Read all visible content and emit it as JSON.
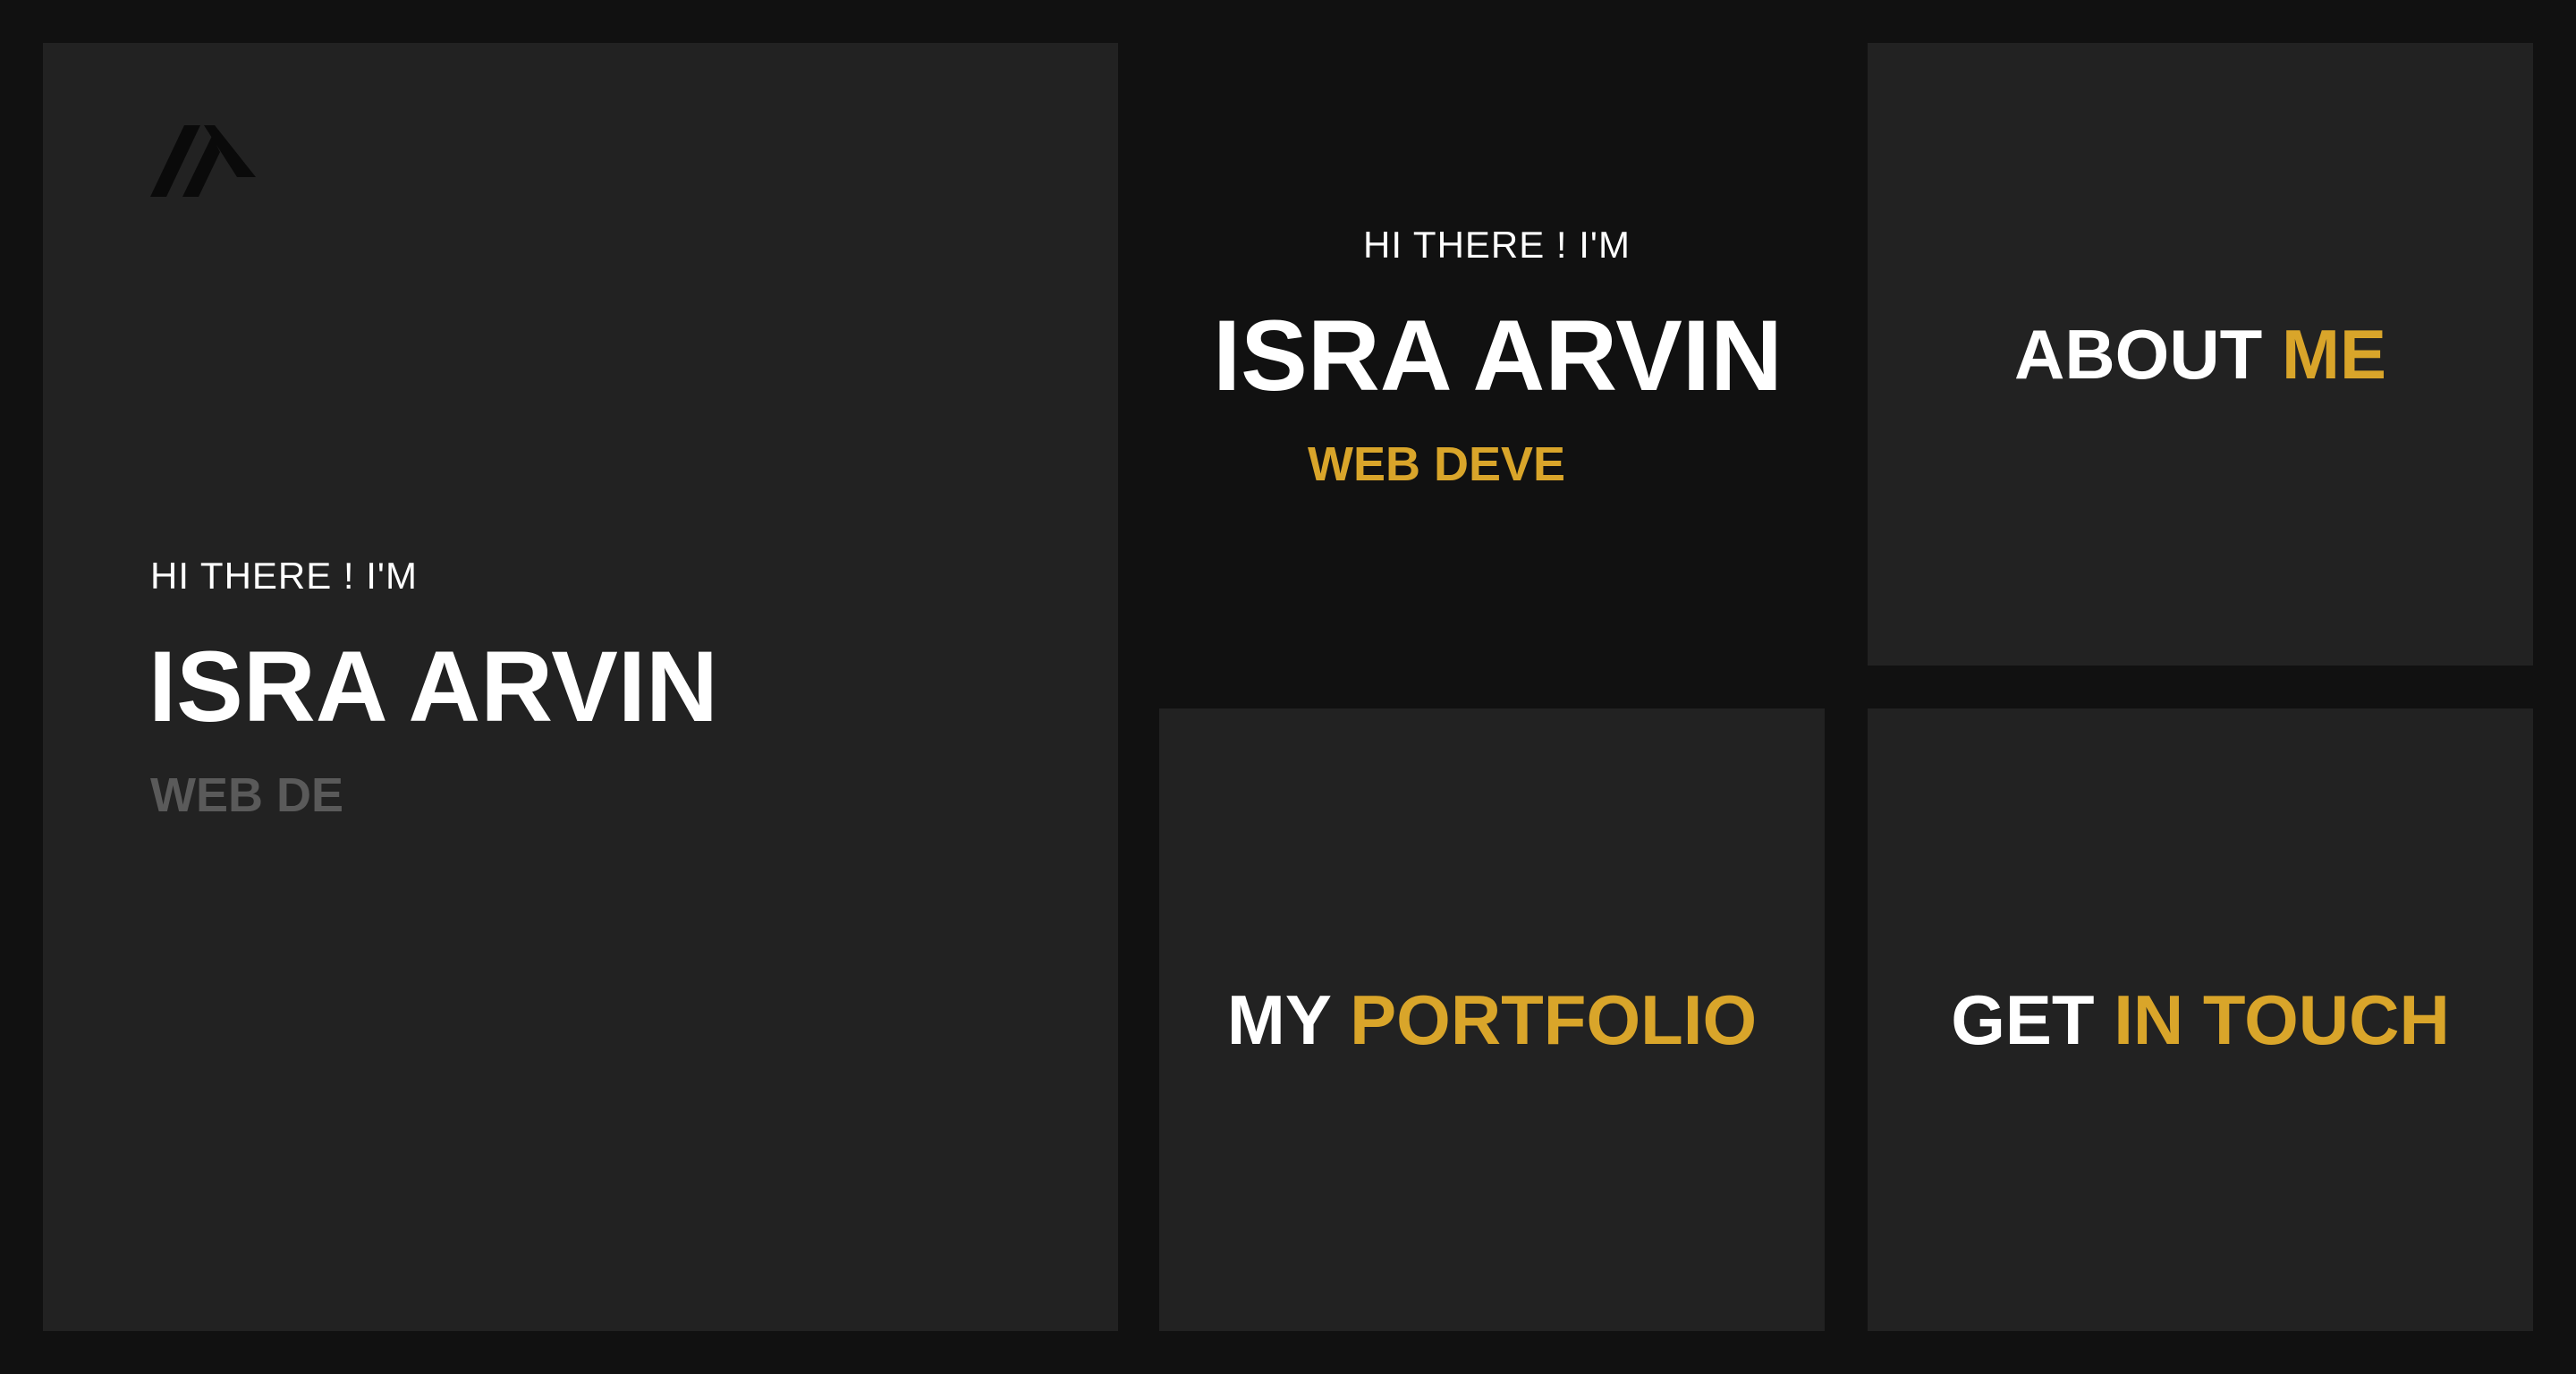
{
  "colors": {
    "background": "#111111",
    "panel": "#222222",
    "accent": "#d9a52a",
    "text": "#ffffff",
    "muted": "#5a5a5a"
  },
  "logo": {
    "icon": "brand-logo-icon"
  },
  "hero": {
    "greeting": "HI THERE ! I'M",
    "name": "ISRA ARVIN",
    "role": "WEB DE"
  },
  "center": {
    "greeting": "HI THERE ! I'M",
    "name": "ISRA ARVIN",
    "role": "WEB DEVE"
  },
  "about": {
    "title_main": "ABOUT",
    "title_accent": "ME"
  },
  "portfolio": {
    "title_main": "MY",
    "title_accent": "PORTFOLIO"
  },
  "contact": {
    "title_main": "GET",
    "title_accent": "IN TOUCH"
  }
}
